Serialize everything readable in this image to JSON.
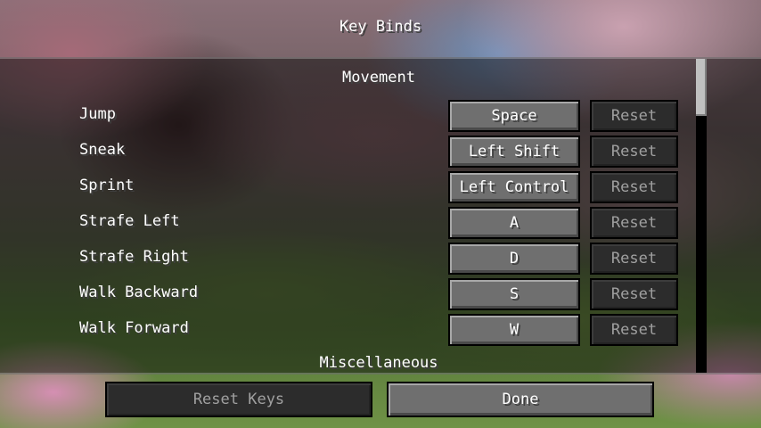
{
  "screen": {
    "title": "Key Binds"
  },
  "sections": [
    {
      "header": "Movement",
      "binds": [
        {
          "label": "Jump",
          "key": "Space",
          "reset": "Reset"
        },
        {
          "label": "Sneak",
          "key": "Left Shift",
          "reset": "Reset"
        },
        {
          "label": "Sprint",
          "key": "Left Control",
          "reset": "Reset"
        },
        {
          "label": "Strafe Left",
          "key": "A",
          "reset": "Reset"
        },
        {
          "label": "Strafe Right",
          "key": "D",
          "reset": "Reset"
        },
        {
          "label": "Walk Backward",
          "key": "S",
          "reset": "Reset"
        },
        {
          "label": "Walk Forward",
          "key": "W",
          "reset": "Reset"
        }
      ]
    },
    {
      "header": "Miscellaneous",
      "binds": []
    }
  ],
  "footer": {
    "reset_keys_label": "Reset Keys",
    "done_label": "Done"
  },
  "colors": {
    "button": "#6f6f6f",
    "button_disabled": "#2c2c2c",
    "text_disabled": "#a0a0a0"
  }
}
